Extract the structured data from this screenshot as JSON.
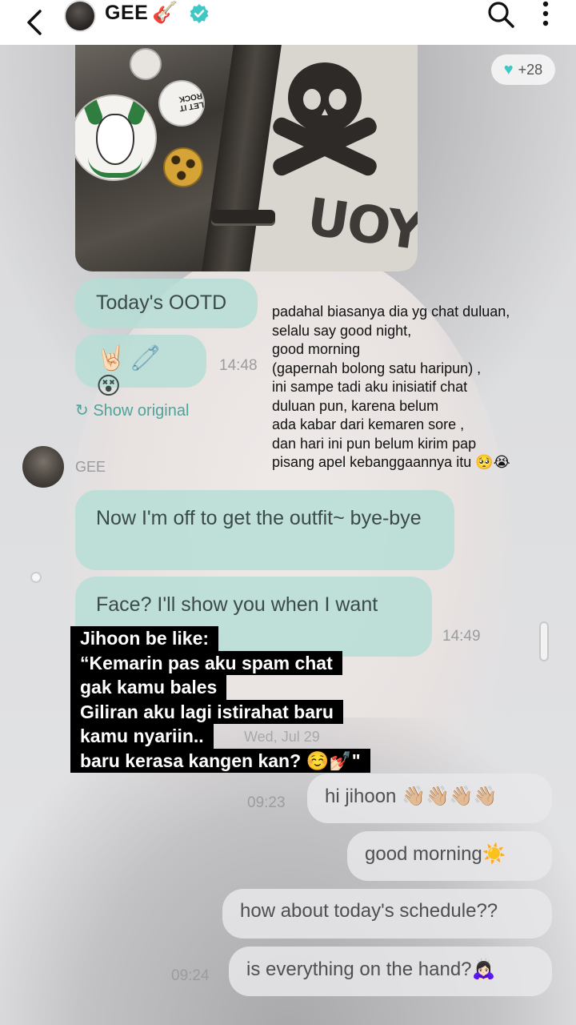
{
  "header": {
    "title": "GEE",
    "title_emoji": "🎸",
    "verified": true,
    "icons": [
      "back-arrow-icon",
      "search-icon",
      "more-vert-icon"
    ]
  },
  "reaction": {
    "count": "+28",
    "icon": "heart-icon",
    "color": "#3ec7c3"
  },
  "image_message": {
    "badge_text": "LET IT ROCK",
    "shirt_text": "UOY"
  },
  "messages_received_1": {
    "ootd": "Today's OOTD",
    "emoji": "🤘🏻🧷😵",
    "time": "14:48",
    "show_original": "Show original"
  },
  "sender": {
    "name": "GEE"
  },
  "messages_received_2": {
    "off": "Now I'm off to get the outfit~ bye-bye",
    "face": "Face? I'll show you when I want",
    "time": "14:49"
  },
  "date_separator": "Wed, Jul 29",
  "messages_sent": [
    {
      "text": "hi jihoon 👋🏼👋🏼👋🏼👋🏼",
      "time": "09:23"
    },
    {
      "text": "good morning☀️",
      "time": ""
    },
    {
      "text": "how about today's schedule??",
      "time": ""
    },
    {
      "text": "is everything on the hand?🙇🏻‍♀️",
      "time": "09:24"
    }
  ],
  "note_lines": [
    "padahal biasanya dia yg chat duluan,",
    "selalu say good night,",
    "good morning",
    "(gapernah bolong satu haripun) ,",
    "ini sampe tadi aku inisiatif chat",
    "duluan pun, karena  belum",
    "ada kabar dari kemaren sore ,",
    "dan hari ini pun belum kirim pap",
    "pisang apel kebanggaannya itu 🥺😭"
  ],
  "caption_lines": [
    "Jihoon be like:",
    "“Kemarin pas aku spam chat",
    "gak kamu bales",
    "Giliran aku lagi istirahat baru",
    "kamu nyariin..",
    "baru kerasa kangen kan? ☺️💅🏻\""
  ],
  "colors": {
    "accent_teal": "#4fa39a",
    "received_bubble": "#b4ded6",
    "sent_bubble": "#e8e8ea",
    "caption_bg": "#000000"
  }
}
